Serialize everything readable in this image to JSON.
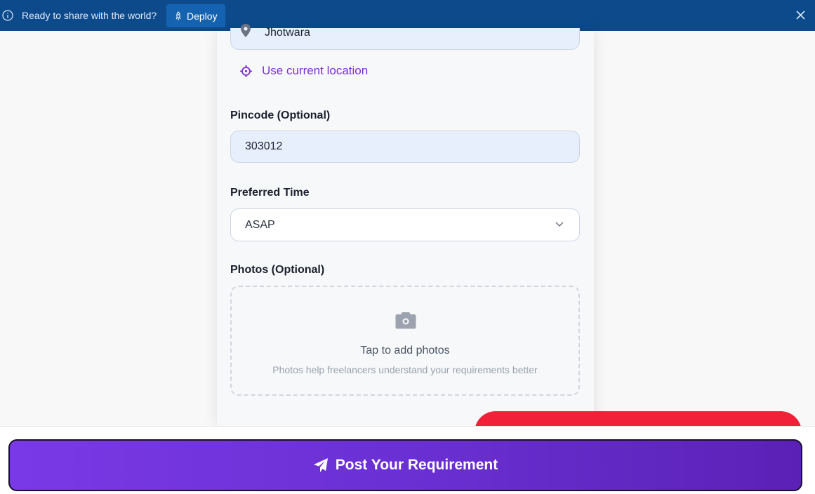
{
  "banner": {
    "message": "Ready to share with the world?",
    "deploy_label": "Deploy",
    "background": "#0c4a8c"
  },
  "form": {
    "location_value": "Jhotwara",
    "use_location_label": "Use current location",
    "pincode_label": "Pincode (Optional)",
    "pincode_value": "303012",
    "time_label": "Preferred Time",
    "time_value": "ASAP",
    "photos_label": "Photos (Optional)",
    "photos_cta": "Tap to add photos",
    "photos_hint": "Photos help freelancers understand your requirements better"
  },
  "footer": {
    "post_label": "Post Your Requirement"
  },
  "colors": {
    "accent": "#7b2fd6",
    "button_gradient_start": "#7a39e6",
    "button_gradient_end": "#5b21b6",
    "alert_red": "#f2213a"
  },
  "icons": [
    "info-icon",
    "rocket-icon",
    "close-icon",
    "map-pin-icon",
    "crosshair-icon",
    "chevron-down-icon",
    "camera-icon",
    "send-icon"
  ]
}
